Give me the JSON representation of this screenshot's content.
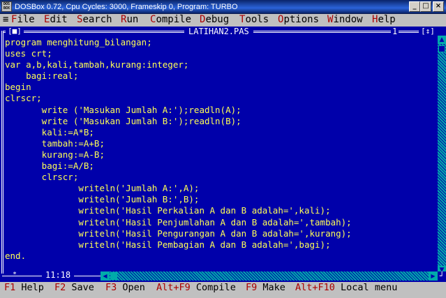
{
  "window": {
    "title": "DOSBox 0.72, Cpu Cycles:    3000, Frameskip  0, Program:   TURBO",
    "icon_text": "DOS BOX",
    "buttons": {
      "minimize": "_",
      "maximize": "□",
      "close": "×"
    }
  },
  "menu": {
    "system": "≡",
    "items": [
      {
        "hotkey": "F",
        "rest": "ile"
      },
      {
        "hotkey": "E",
        "rest": "dit"
      },
      {
        "hotkey": "S",
        "rest": "earch"
      },
      {
        "hotkey": "R",
        "rest": "un"
      },
      {
        "hotkey": "C",
        "rest": "ompile"
      },
      {
        "hotkey": "D",
        "rest": "ebug"
      },
      {
        "hotkey": "T",
        "rest": "ools"
      },
      {
        "hotkey": "O",
        "rest": "ptions"
      },
      {
        "hotkey": "W",
        "rest": "indow"
      },
      {
        "hotkey": "H",
        "rest": "elp"
      }
    ]
  },
  "editor": {
    "close_box": "[■]",
    "file_name": "LATIHAN2.PAS",
    "window_number": "1",
    "zoom_box": "[↕]",
    "cursor_position": "11:18",
    "modified_mark": "*",
    "lines": [
      "program menghitung_bilangan;",
      "uses crt;",
      "var a,b,kali,tambah,kurang:integer;",
      "    bagi:real;",
      "begin",
      "clrscr;",
      "       write ('Masukan Jumlah A:');readln(A);",
      "       write ('Masukan Jumlah B:');readln(B);",
      "       kali:=A*B;",
      "       tambah:=A+B;",
      "       kurang:=A-B;",
      "       bagi:=A/B;",
      "       clrscr;",
      "              writeln('Jumlah A:',A);",
      "              writeln('Jumlah B:',B);",
      "              writeln('Hasil Perkalian A dan B adalah=',kali);",
      "              writeln('Hasil Penjumlahan A dan B adalah=',tambah);",
      "              writeln('Hasil Pengurangan A dan B adalah=',kurang);",
      "              writeln('Hasil Pembagian A dan B adalah=',bagi);",
      "end."
    ]
  },
  "fkeys": [
    {
      "key": "F1",
      "label": "Help"
    },
    {
      "key": "F2",
      "label": "Save"
    },
    {
      "key": "F3",
      "label": "Open"
    },
    {
      "key": "Alt+F9",
      "label": "Compile"
    },
    {
      "key": "F9",
      "label": "Make"
    },
    {
      "key": "Alt+F10",
      "label": "Local menu"
    }
  ],
  "colors": {
    "editor_bg": "#0000aa",
    "code_text": "#ffff55",
    "menu_bg": "#c0c0c0",
    "hotkey": "#aa0000",
    "scrollbar": "#00aaaa"
  }
}
